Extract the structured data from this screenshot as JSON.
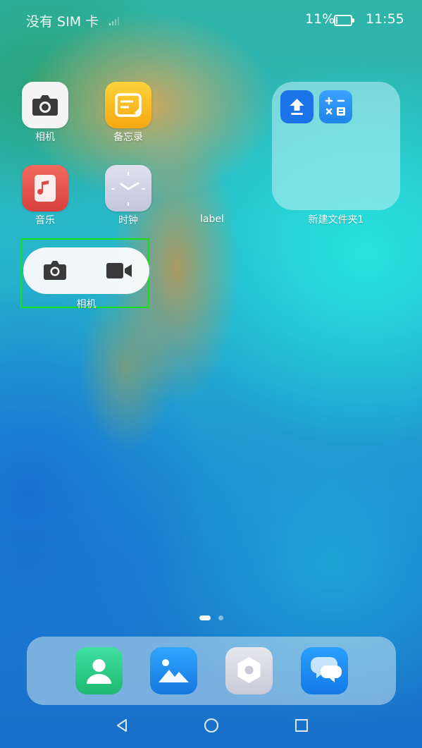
{
  "status_bar": {
    "carrier": "没有 SIM 卡",
    "battery_percent": "11%",
    "battery_level": 0.11,
    "time": "11:55",
    "signal_icon": "signal-bars-icon",
    "battery_icon": "battery-icon"
  },
  "apps": [
    {
      "label": "相机",
      "icon": "camera-icon",
      "color": "#f2f2f2"
    },
    {
      "label": "备忘录",
      "icon": "notes-icon",
      "color": "#f9b81c"
    },
    {
      "label": "音乐",
      "icon": "music-icon",
      "color": "#e8524f"
    },
    {
      "label": "时钟",
      "icon": "clock-icon",
      "color": "#c9cbe0"
    }
  ],
  "loose_label": "label",
  "folder": {
    "label": "新建文件夹1",
    "apps": [
      {
        "icon": "upload-icon",
        "color": "#1a73e8"
      },
      {
        "icon": "calculator-icon",
        "color": "#2196f3"
      }
    ]
  },
  "widget": {
    "label": "相机",
    "photo_icon": "camera-icon",
    "video_icon": "video-camera-icon"
  },
  "page_indicator": {
    "current": 1,
    "total": 2
  },
  "dock": [
    {
      "icon": "contacts-icon",
      "color": "#2ecc8a"
    },
    {
      "icon": "gallery-icon",
      "color": "#1e8cf0"
    },
    {
      "icon": "settings-icon",
      "color": "#d8d8e2"
    },
    {
      "icon": "messages-icon",
      "color": "#1e90f5"
    }
  ],
  "nav": {
    "back_icon": "back-triangle-icon",
    "home_icon": "home-circle-icon",
    "recents_icon": "recents-square-icon"
  }
}
